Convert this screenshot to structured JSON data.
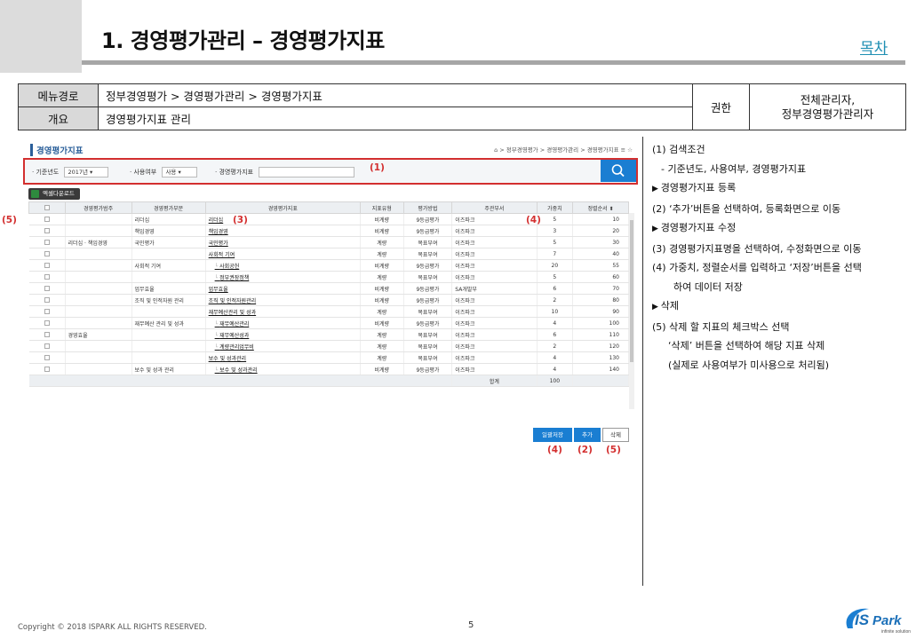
{
  "title": "1. 경영평가관리 – 경영평가지표",
  "toc_link": "목차",
  "meta": {
    "menu_label": "메뉴경로",
    "menu_value": "정부경영평가  >  경영평가관리  >  경영평가지표",
    "summary_label": "개요",
    "summary_value": "경영평가지표  관리",
    "auth_label": "권한",
    "auth_value_1": "전체관리자,",
    "auth_value_2": "정부경영평가관리자"
  },
  "app": {
    "page_title": "경영평가지표",
    "breadcrumb": "⌂  >  정부경영평가  >  경영평가관리  >  경영평가지표   ≡   ☆",
    "search": {
      "year_label": "· 기준년도",
      "year_value": "2017년  ▾",
      "use_label": "· 사용여부",
      "use_value": "사용  ▾",
      "name_label": "· 경영평가지표"
    },
    "excel_button": "엑셀다운로드",
    "columns": [
      "",
      "경영평가범주",
      "경영평가부문",
      "경영평가지표",
      "지표유형",
      "평가방법",
      "주관부서",
      "가중치",
      "정렬순서 ⬍"
    ],
    "rows": [
      {
        "cat": "",
        "part": "리더십",
        "name": "리더십",
        "sub": false,
        "type": "비계량",
        "method": "9등급평가",
        "dept": "이즈파크",
        "w": "5",
        "o": "10"
      },
      {
        "cat": "",
        "part": "책임경영",
        "name": "책임경영",
        "sub": false,
        "type": "비계량",
        "method": "9등급평가",
        "dept": "이즈파크",
        "w": "3",
        "o": "20"
      },
      {
        "cat": "리더십 · 책임경영",
        "part": "국민평가",
        "name": "국민평가",
        "sub": false,
        "type": "계량",
        "method": "목표부여",
        "dept": "이즈파크",
        "w": "5",
        "o": "30"
      },
      {
        "cat": "",
        "part": "",
        "name": "사회적 기여",
        "sub": false,
        "type": "계량",
        "method": "목표부여",
        "dept": "이즈파크",
        "w": "7",
        "o": "40"
      },
      {
        "cat": "",
        "part": "사회적 기여",
        "name": "사회공헌",
        "sub": true,
        "type": "비계량",
        "method": "9등급평가",
        "dept": "이즈파크",
        "w": "20",
        "o": "55"
      },
      {
        "cat": "",
        "part": "",
        "name": "정부권장정책",
        "sub": true,
        "type": "계량",
        "method": "목표부여",
        "dept": "이즈파크",
        "w": "5",
        "o": "60"
      },
      {
        "cat": "",
        "part": "업무효율",
        "name": "업무효율",
        "sub": false,
        "type": "비계량",
        "method": "9등급평가",
        "dept": "SA개발부",
        "w": "6",
        "o": "70"
      },
      {
        "cat": "",
        "part": "조직 및 인적자원 관리",
        "name": "조직 및 인적자원관리",
        "sub": false,
        "type": "비계량",
        "method": "9등급평가",
        "dept": "이즈파크",
        "w": "2",
        "o": "80"
      },
      {
        "cat": "",
        "part": "",
        "name": "재무예산관리 및 성과",
        "sub": false,
        "type": "계량",
        "method": "목표부여",
        "dept": "이즈파크",
        "w": "10",
        "o": "90"
      },
      {
        "cat": "",
        "part": "재무예산 관리 및 성과",
        "name": "재무예산관리",
        "sub": true,
        "type": "비계량",
        "method": "9등급평가",
        "dept": "이즈파크",
        "w": "4",
        "o": "100"
      },
      {
        "cat": "경영효율",
        "part": "",
        "name": "재무예산성과",
        "sub": true,
        "type": "계량",
        "method": "목표부여",
        "dept": "이즈파크",
        "w": "6",
        "o": "110"
      },
      {
        "cat": "",
        "part": "",
        "name": "계량관리업무비",
        "sub": true,
        "type": "계량",
        "method": "목표부여",
        "dept": "이즈파크",
        "w": "2",
        "o": "120"
      },
      {
        "cat": "",
        "part": "",
        "name": "보수 및 성과관리",
        "sub": false,
        "type": "계량",
        "method": "목표부여",
        "dept": "이즈파크",
        "w": "4",
        "o": "130"
      },
      {
        "cat": "",
        "part": "보수 및 성과 관리",
        "name": "보수 및 성과관리",
        "sub": true,
        "type": "비계량",
        "method": "9등급평가",
        "dept": "이즈파크",
        "w": "4",
        "o": "140"
      }
    ],
    "total_label": "합계",
    "total_value": "100",
    "buttons": {
      "save": "일괄저장",
      "add": "추가",
      "delete": "삭제"
    },
    "annotations": {
      "a1": "(1)",
      "a3": "(3)",
      "a4": "(4)",
      "a5": "(5)",
      "b4": "(4)",
      "b2": "(2)",
      "b5": "(5)"
    }
  },
  "notes": [
    "(1)   검색조건",
    "- 기준년도, 사용여부, 경영평가지표",
    "경영평가지표 등록",
    "(2)   ‘추가’버튼을 선택하여, 등록화면으로 이동",
    "경영평가지표 수정",
    "(3)   경영평가지표명을 선택하여, 수정화면으로 이동",
    "(4)   가중치, 정렬순서를 입력하고 ‘저장’버튼을 선택",
    "하여 데이터 저장",
    "삭제",
    "(5)   삭제 할 지표의 체크박스 선택",
    "‘삭제’ 버튼을 선택하여 해당 지표 삭제",
    "(실제로 사용여부가 미사용으로 처리됨)"
  ],
  "footer": "Copyright © 2018 ISPARK ALL RIGHTS RESERVED.",
  "page_number": "5",
  "logo_text": "ISPark",
  "logo_tagline": "infinite solution",
  "colors": {
    "accent_red": "#d32f2f",
    "primary_blue": "#1a7ed2",
    "link_teal": "#1f8fb3"
  }
}
